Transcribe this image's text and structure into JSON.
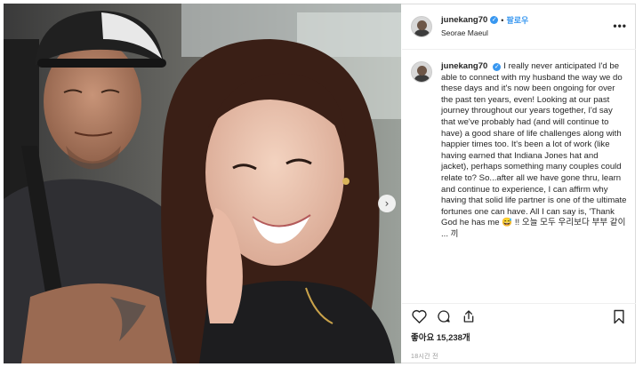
{
  "post": {
    "username": "junekang70",
    "follow_label": "팔로우",
    "separator": "•",
    "location": "Seorae Maeul",
    "more_label": "•••",
    "caption_text": "I really never anticipated I'd be able to connect with my husband the way we do these days and it's now been ongoing for over the past ten years, even! Looking at our past journey throughout our years together, I'd say that we've probably had (and will continue to have) a good share of life challenges along with happier times too. It's been a lot of work (like having earned that Indiana Jones hat and jacket), perhaps something many couples could relate to? So...after all we have gone thru, learn and continue to experience, I can affirm why having that solid life partner is one of the ultimate fortunes one can have. All I can say is, 'Thank God he has me 😅 !! 오늘 모두 우리보다 부부 같이 ... 끼",
    "likes": "좋아요 15,238개",
    "time_ago": "18시간 전"
  },
  "icons": {
    "verified": "verified-badge-icon",
    "like": "heart-icon",
    "comment": "comment-icon",
    "share": "share-icon",
    "save": "bookmark-icon",
    "carousel_next": "chevron-right-icon"
  },
  "colors": {
    "accent": "#3897f0",
    "text": "#262626",
    "muted": "#999999",
    "border": "#dbdbdb"
  }
}
